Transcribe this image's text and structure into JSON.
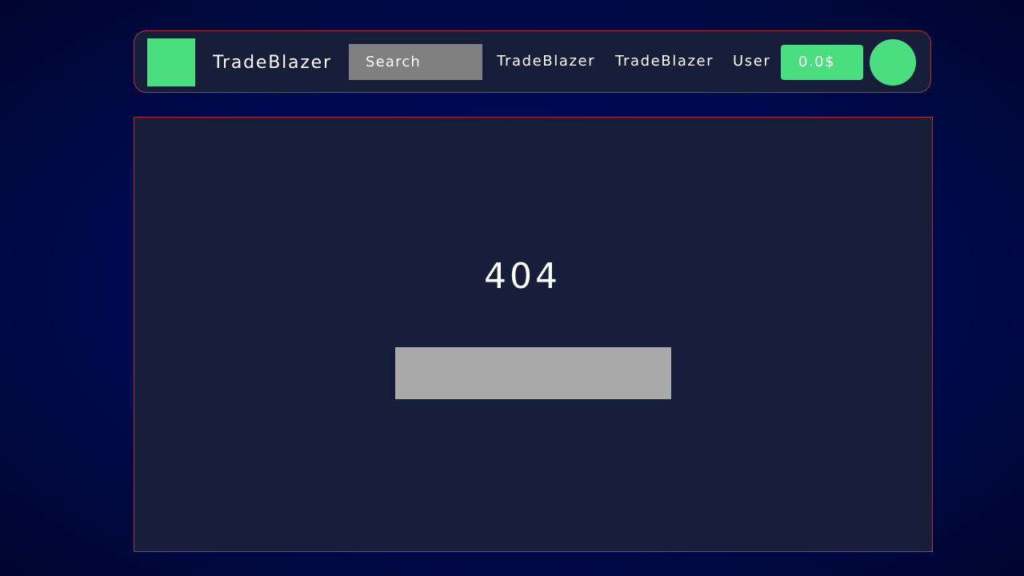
{
  "header": {
    "brand": "TradeBlazer",
    "search": {
      "placeholder": "Search"
    },
    "nav_links": [
      {
        "label": "TradeBlazer"
      },
      {
        "label": "TradeBlazer"
      },
      {
        "label": "User"
      }
    ],
    "balance": "0.0$",
    "avatar_icon": "user-avatar-circle"
  },
  "main": {
    "error_code": "404",
    "action_block_label": ""
  },
  "colors": {
    "accent": "#4ade80",
    "panel": "#161e3a",
    "border": "#b0323c",
    "search_bg": "#808080",
    "block_bg": "#a9a9a9"
  }
}
